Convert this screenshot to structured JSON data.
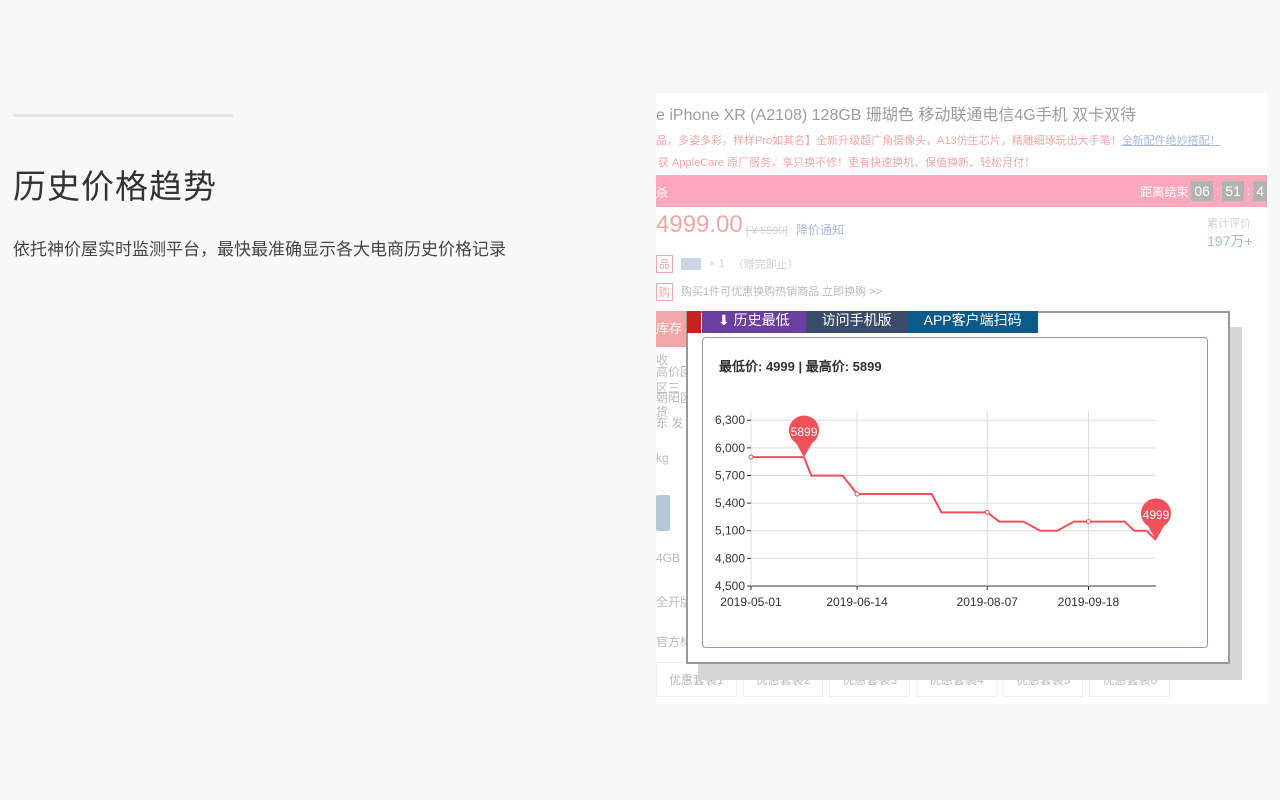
{
  "hero": {
    "title": "历史价格趋势",
    "subtitle": "依托神价屋实时监测平台，最快最准确显示各大电商历史价格记录"
  },
  "product": {
    "title": "e iPhone XR (A2108) 128GB 珊瑚色 移动联通电信4G手机 双卡双待",
    "promo_line1": "品，多姿多彩，样样Pro如其名】全新升级超广角摄像头，A13仿生芯片，精雕细琢玩出大手笔！",
    "promo_link": "全新配件绝妙搭配！",
    "promo_line2": "获 AppleCare 原厂服务，享只换不修！更有快速换机、保值换新、轻松月付！",
    "flash_label": "杀",
    "countdown_label": "距离结束",
    "countdown": [
      "06",
      "51",
      "4"
    ],
    "price": "4999.00",
    "orig_price": "[￥5599]",
    "price_notify": "降价通知",
    "sales_label": "累计评价",
    "sales_count": "197万+",
    "gift_tag": "品",
    "gift_qty": "× 1",
    "gift_note": "（赠完即止）",
    "swap_tag": "购",
    "swap_text": "购买1件可优惠换购热销商品 立即换购 >>",
    "stock_label": "库存",
    "side_rows": [
      "收",
      "高价回",
      "区三",
      "朝阳区",
      "货",
      "东 发",
      "kg"
    ],
    "storage": "4GB",
    "contract": "全开版",
    "mark": "官方标配",
    "bundles": [
      "优惠套装1",
      "优惠套装2",
      "优惠套装3",
      "优惠套装4",
      "优惠套装5",
      "优惠套装6"
    ]
  },
  "popup": {
    "tabs": [
      "⬇ 历史最低",
      "访问手机版",
      "APP客户端扫码"
    ],
    "summary": "最低价: 4999 | 最高价: 5899",
    "max_pin": "5899",
    "min_pin": "4999"
  },
  "chart_data": {
    "type": "line",
    "title": "",
    "xlabel": "",
    "ylabel": "",
    "ylim": [
      4500,
      6400
    ],
    "yticks": [
      4500,
      4800,
      5100,
      5400,
      5700,
      6000,
      6300
    ],
    "ytick_labels": [
      "4,500",
      "4,800",
      "5,100",
      "5,400",
      "5,700",
      "6,000",
      "6,300"
    ],
    "xticks": [
      "2019-05-01",
      "2019-06-14",
      "2019-08-07",
      "2019-09-18"
    ],
    "x_range": [
      "2019-05-01",
      "2019-10-16"
    ],
    "color": "#f0505a",
    "grid": true,
    "series": [
      {
        "points": [
          [
            "2019-05-01",
            5899
          ],
          [
            "2019-05-23",
            5899
          ],
          [
            "2019-05-26",
            5699
          ],
          [
            "2019-06-08",
            5699
          ],
          [
            "2019-06-14",
            5499
          ],
          [
            "2019-07-15",
            5499
          ],
          [
            "2019-07-19",
            5299
          ],
          [
            "2019-08-07",
            5299
          ],
          [
            "2019-08-12",
            5199
          ],
          [
            "2019-08-22",
            5199
          ],
          [
            "2019-08-29",
            5099
          ],
          [
            "2019-09-05",
            5099
          ],
          [
            "2019-09-12",
            5199
          ],
          [
            "2019-09-18",
            5199
          ],
          [
            "2019-10-03",
            5199
          ],
          [
            "2019-10-07",
            5099
          ],
          [
            "2019-10-12",
            5099
          ],
          [
            "2019-10-16",
            4999
          ]
        ]
      }
    ],
    "annotations": [
      {
        "label": "5899",
        "x": "2019-05-23",
        "y": 5899
      },
      {
        "label": "4999",
        "x": "2019-10-16",
        "y": 4999
      }
    ]
  }
}
